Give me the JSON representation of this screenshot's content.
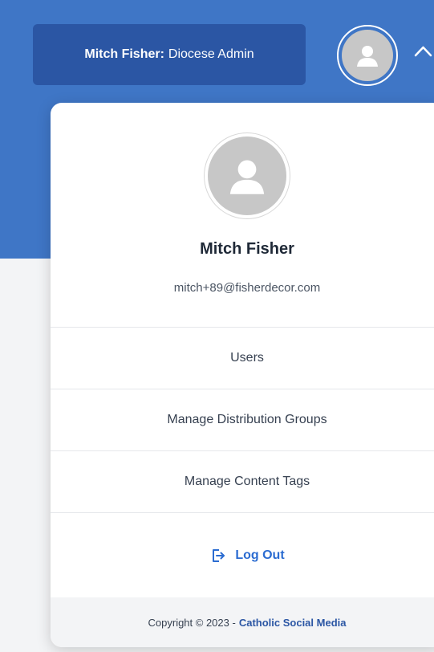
{
  "header": {
    "user_name_prefix": "Mitch Fisher:",
    "role": "Diocese Admin",
    "avatar_icon": "user-avatar-icon",
    "toggle_icon": "chevron-up-icon"
  },
  "profile": {
    "name": "Mitch Fisher",
    "email": "mitch+89@fisherdecor.com",
    "avatar_icon": "user-avatar-icon"
  },
  "menu": {
    "items": [
      {
        "label": "Users"
      },
      {
        "label": "Manage Distribution Groups"
      },
      {
        "label": "Manage Content Tags"
      }
    ]
  },
  "logout": {
    "label": "Log Out",
    "icon": "logout-icon"
  },
  "footer": {
    "copyright": "Copyright © 2023 -",
    "link_text": "Catholic Social Media"
  },
  "colors": {
    "header_bg": "#3f76c6",
    "badge_bg": "#2b56a4",
    "link": "#2b6cd1"
  }
}
